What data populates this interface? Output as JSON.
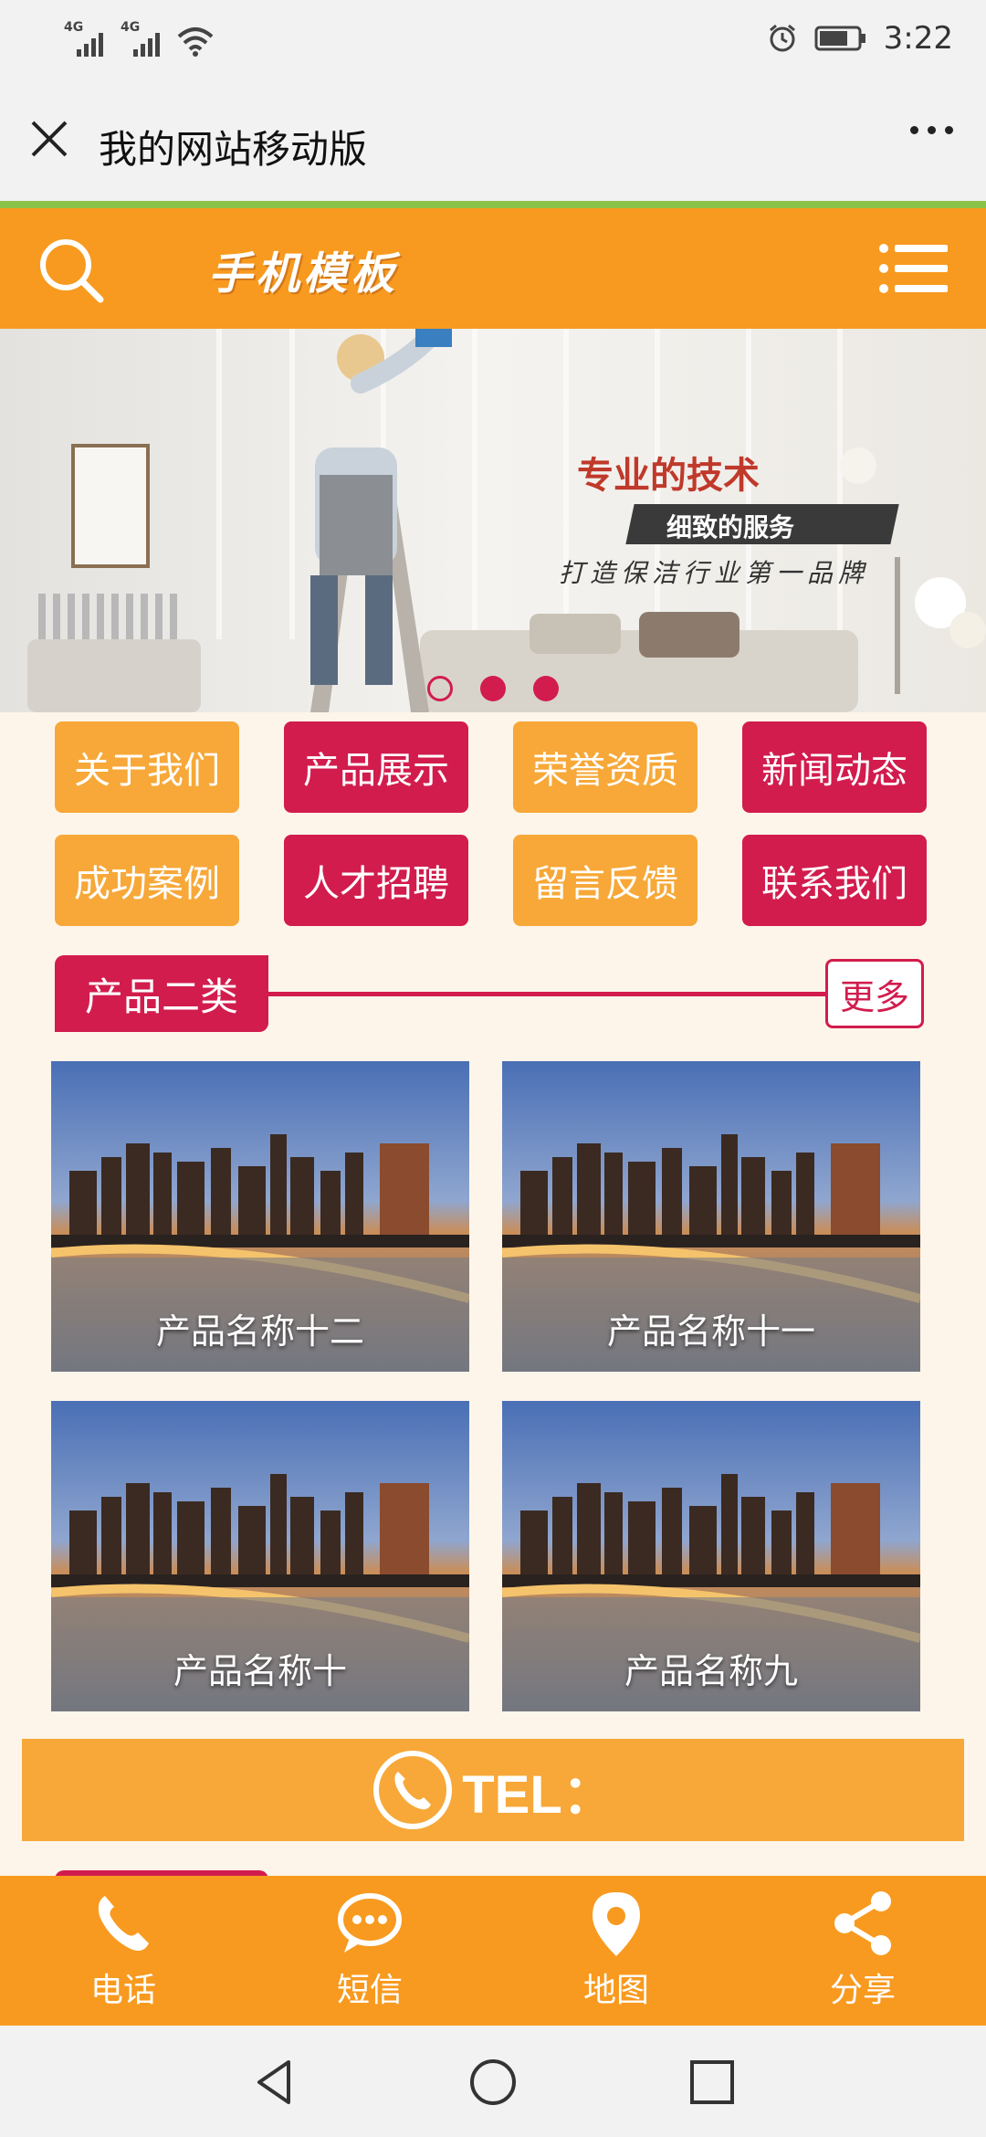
{
  "status_bar": {
    "signal1_label": "4G",
    "signal2_label": "4G",
    "time": "3:22"
  },
  "title_bar": {
    "title": "我的网站移动版"
  },
  "header": {
    "brand": "手机模板"
  },
  "banner": {
    "headline": "专业的技术",
    "subline": "细致的服务",
    "tagline": "打造保洁行业第一品牌",
    "slide_count": 3,
    "active_slide": 1
  },
  "nav": [
    {
      "label": "关于我们",
      "color": "#f7a838"
    },
    {
      "label": "产品展示",
      "color": "#d21c4d"
    },
    {
      "label": "荣誉资质",
      "color": "#f7a838"
    },
    {
      "label": "新闻动态",
      "color": "#d21c4d"
    },
    {
      "label": "成功案例",
      "color": "#f7a838"
    },
    {
      "label": "人才招聘",
      "color": "#d21c4d"
    },
    {
      "label": "留言反馈",
      "color": "#f7a838"
    },
    {
      "label": "联系我们",
      "color": "#d21c4d"
    }
  ],
  "section": {
    "title": "产品二类",
    "more_label": "更多"
  },
  "products": [
    {
      "name": "产品名称十二"
    },
    {
      "name": "产品名称十一"
    },
    {
      "name": "产品名称十"
    },
    {
      "name": "产品名称九"
    }
  ],
  "tel_bar": {
    "label": "TEL："
  },
  "bottom_nav": [
    {
      "label": "电话",
      "icon": "phone-icon"
    },
    {
      "label": "短信",
      "icon": "message-icon"
    },
    {
      "label": "地图",
      "icon": "map-pin-icon"
    },
    {
      "label": "分享",
      "icon": "share-icon"
    }
  ],
  "colors": {
    "orange": "#f89a1f",
    "light_orange": "#f7a838",
    "crimson": "#d21c4d",
    "page_bg": "#fdf5ea"
  }
}
